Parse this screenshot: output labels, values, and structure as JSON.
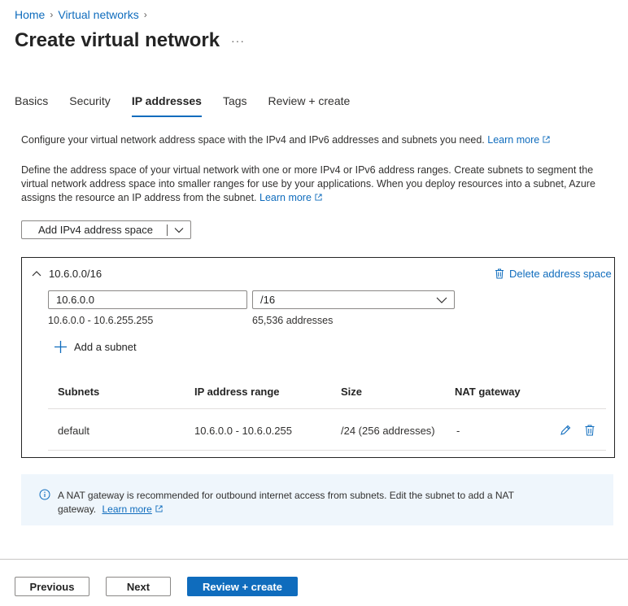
{
  "breadcrumb": {
    "home": "Home",
    "virtual_networks": "Virtual networks"
  },
  "page": {
    "title": "Create virtual network",
    "more": "···"
  },
  "tabs": [
    {
      "label": "Basics"
    },
    {
      "label": "Security"
    },
    {
      "label": "IP addresses",
      "active": true
    },
    {
      "label": "Tags"
    },
    {
      "label": "Review + create"
    }
  ],
  "intro": {
    "line1": "Configure your virtual network address space with the IPv4 and IPv6 addresses and subnets you need.",
    "learn_more": "Learn more",
    "line2": "Define the address space of your virtual network with one or more IPv4 or IPv6 address ranges. Create subnets to segment the virtual network address space into smaller ranges for use by your applications. When you deploy resources into a subnet, Azure assigns the resource an IP address from the subnet."
  },
  "add_space_button": {
    "label": "Add IPv4 address space"
  },
  "address_space": {
    "name": "10.6.0.0/16",
    "delete_label": "Delete address space",
    "address_value": "10.6.0.0",
    "prefix_value": "/16",
    "range_text": "10.6.0.0 - 10.6.255.255",
    "count_text": "65,536 addresses",
    "add_subnet_label": "Add a subnet",
    "table": {
      "headers": [
        "Subnets",
        "IP address range",
        "Size",
        "NAT gateway"
      ],
      "rows": [
        {
          "name": "default",
          "range": "10.6.0.0 - 10.6.0.255",
          "size": "/24 (256 addresses)",
          "nat": "-"
        }
      ]
    }
  },
  "info": {
    "text": "A NAT gateway is recommended for outbound internet access from subnets. Edit the subnet to add a NAT gateway.",
    "learn_more": "Learn more"
  },
  "footer": {
    "previous": "Previous",
    "next": "Next",
    "review_create": "Review + create"
  },
  "colors": {
    "accent": "#0f6cbd",
    "info_bg": "#eff6fc"
  }
}
